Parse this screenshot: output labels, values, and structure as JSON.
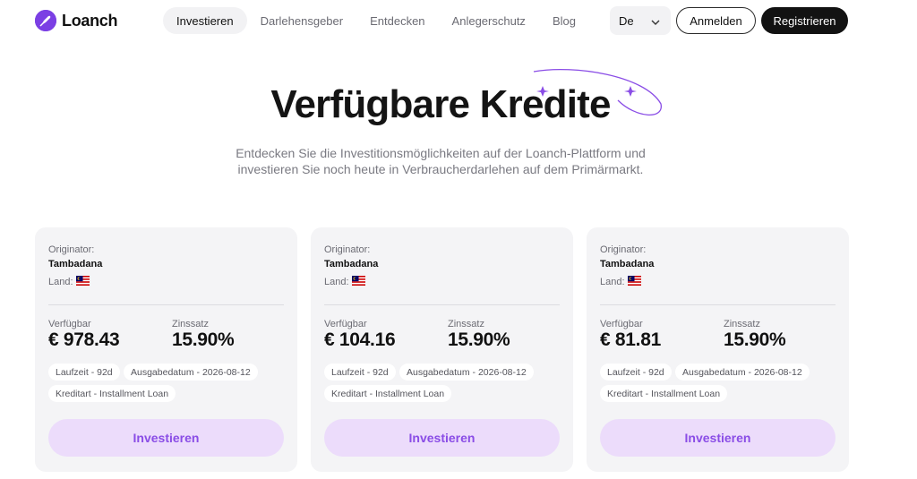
{
  "header": {
    "logo_text": "Loanch",
    "nav": [
      {
        "label": "Investieren",
        "active": true
      },
      {
        "label": "Darlehensgeber",
        "active": false
      },
      {
        "label": "Entdecken",
        "active": false
      },
      {
        "label": "Anlegerschutz",
        "active": false
      },
      {
        "label": "Blog",
        "active": false
      }
    ],
    "language": "De",
    "login_label": "Anmelden",
    "register_label": "Registrieren"
  },
  "hero": {
    "title": "Verfügbare Kredite",
    "subtitle_line1": "Entdecken Sie die Investitionsmöglichkeiten auf der Loanch-Plattform und",
    "subtitle_line2": "investieren Sie noch heute in Verbraucherdarlehen auf dem Primärmarkt."
  },
  "cards": [
    {
      "originator_label": "Originator:",
      "originator": "Tambadana",
      "country_label": "Land:",
      "country_flag": "malaysia-flag",
      "available_label": "Verfügbar",
      "available": "€ 978.43",
      "rate_label": "Zinssatz",
      "rate": "15.90%",
      "term": "Laufzeit - 92d",
      "issue_date": "Ausgabedatum - 2026-08-12",
      "loan_type": "Kreditart - Installment Loan",
      "invest_label": "Investieren"
    },
    {
      "originator_label": "Originator:",
      "originator": "Tambadana",
      "country_label": "Land:",
      "country_flag": "malaysia-flag",
      "available_label": "Verfügbar",
      "available": "€ 104.16",
      "rate_label": "Zinssatz",
      "rate": "15.90%",
      "term": "Laufzeit - 92d",
      "issue_date": "Ausgabedatum - 2026-08-12",
      "loan_type": "Kreditart - Installment Loan",
      "invest_label": "Investieren"
    },
    {
      "originator_label": "Originator:",
      "originator": "Tambadana",
      "country_label": "Land:",
      "country_flag": "malaysia-flag",
      "available_label": "Verfügbar",
      "available": "€ 81.81",
      "rate_label": "Zinssatz",
      "rate": "15.90%",
      "term": "Laufzeit - 92d",
      "issue_date": "Ausgabedatum - 2026-08-12",
      "loan_type": "Kreditart - Installment Loan",
      "invest_label": "Investieren"
    }
  ],
  "colors": {
    "brand": "#7b3fe4",
    "accent_button_bg": "#ecdcfb",
    "accent_button_text": "#8a4de6",
    "dark_button": "#121212",
    "card_bg": "#f4f4f6"
  }
}
